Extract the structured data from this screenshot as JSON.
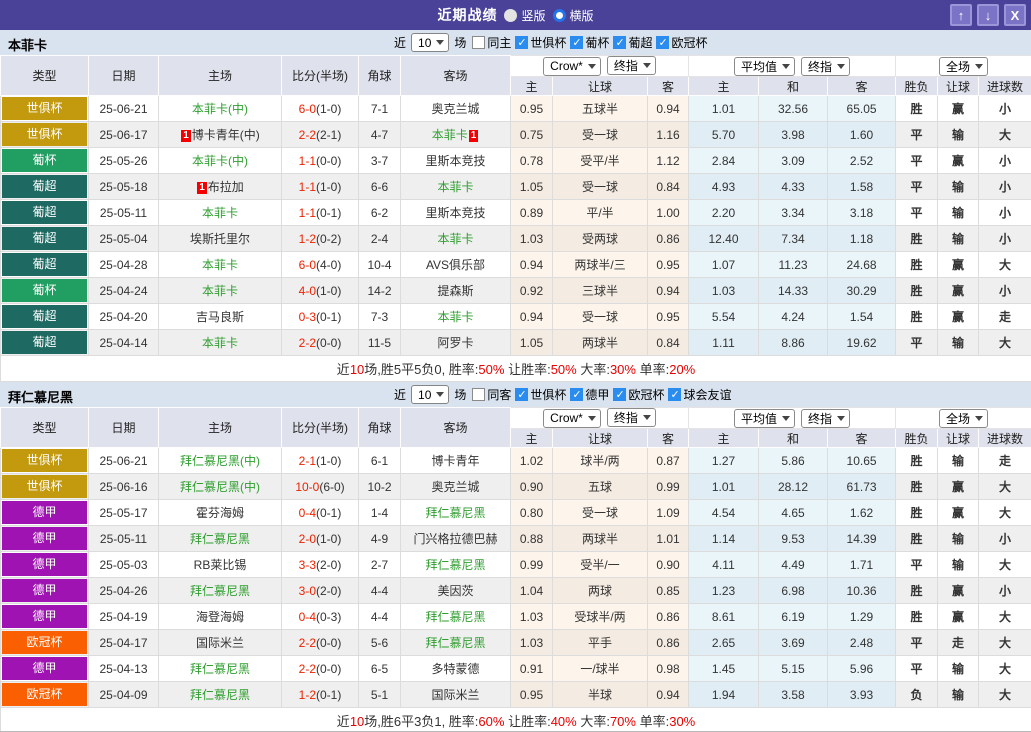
{
  "titlebar": {
    "title": "近期战绩",
    "radios": [
      {
        "label": "竖版"
      },
      {
        "label": "横版"
      }
    ],
    "buttons": [
      {
        "name": "move-up-button",
        "icon": "up-arrow-icon",
        "glyph": "↑"
      },
      {
        "name": "move-down-button",
        "icon": "down-arrow-icon",
        "glyph": "↓"
      },
      {
        "name": "close-button",
        "icon": "close-icon",
        "glyph": "X"
      }
    ]
  },
  "columns": {
    "left": [
      "类型",
      "日期",
      "主场",
      "比分(半场)",
      "角球",
      "客场"
    ],
    "sub": [
      "主",
      "让球",
      "客",
      "主",
      "和",
      "客",
      "胜负",
      "让球",
      "进球数"
    ]
  },
  "colors": {
    "accent_purple": "#4a4298",
    "worldclub": "#c3990e",
    "pt_cup": "#219e61",
    "pt_league": "#1e6a62",
    "bundesliga": "#a013b3",
    "ucl": "#fa5f02",
    "win_red": "#e60000",
    "draw_green": "#1f9a1f",
    "loss_blue": "#2222cc"
  },
  "sections": [
    {
      "team": "本菲卡",
      "filter": {
        "near": "近",
        "count": "10",
        "games": "场",
        "same": "同主",
        "same_checked": false,
        "leagues": [
          "世俱杯",
          "葡杯",
          "葡超",
          "欧冠杯"
        ]
      },
      "selects": {
        "book": "Crow*",
        "book_type": "终指",
        "avg": "平均值",
        "avg_type": "终指",
        "scope": "全场"
      },
      "rows": [
        {
          "lg": "世俱杯",
          "lc": "#c3990e",
          "dt": "25-06-21",
          "hm": "本菲卡(中)",
          "hg": true,
          "hcard": false,
          "sc": "6-0",
          "hf": "(1-0)",
          "cn": "7-1",
          "aw": "奥克兰城",
          "ag": false,
          "acard": false,
          "o1": "0.95",
          "ln": "五球半",
          "o2": "0.94",
          "m1": "1.01",
          "m2": "32.56",
          "m3": "65.05",
          "r1": "胜",
          "c1": "red",
          "r2": "赢",
          "c2": "red",
          "r3": "小",
          "c3": "blue"
        },
        {
          "lg": "世俱杯",
          "lc": "#c3990e",
          "dt": "25-06-17",
          "hm": "博卡青年(中)",
          "hg": false,
          "hcard": true,
          "sc": "2-2",
          "hf": "(2-1)",
          "cn": "4-7",
          "aw": "本菲卡",
          "ag": true,
          "acard": true,
          "o1": "0.75",
          "ln": "受一球",
          "o2": "1.16",
          "m1": "5.70",
          "m2": "3.98",
          "m3": "1.60",
          "r1": "平",
          "c1": "green",
          "r2": "输",
          "c2": "blue",
          "r3": "大",
          "c3": "red"
        },
        {
          "lg": "葡杯",
          "lc": "#219e61",
          "dt": "25-05-26",
          "hm": "本菲卡(中)",
          "hg": true,
          "hcard": false,
          "sc": "1-1",
          "hf": "(0-0)",
          "cn": "3-7",
          "aw": "里斯本竞技",
          "ag": false,
          "acard": false,
          "o1": "0.78",
          "ln": "受平/半",
          "o2": "1.12",
          "m1": "2.84",
          "m2": "3.09",
          "m3": "2.52",
          "r1": "平",
          "c1": "green",
          "r2": "赢",
          "c2": "red",
          "r3": "小",
          "c3": "blue"
        },
        {
          "lg": "葡超",
          "lc": "#1e6a62",
          "dt": "25-05-18",
          "hm": "布拉加",
          "hg": false,
          "hcard": true,
          "sc": "1-1",
          "hf": "(1-0)",
          "cn": "6-6",
          "aw": "本菲卡",
          "ag": true,
          "acard": false,
          "o1": "1.05",
          "ln": "受一球",
          "o2": "0.84",
          "m1": "4.93",
          "m2": "4.33",
          "m3": "1.58",
          "r1": "平",
          "c1": "green",
          "r2": "输",
          "c2": "blue",
          "r3": "小",
          "c3": "blue"
        },
        {
          "lg": "葡超",
          "lc": "#1e6a62",
          "dt": "25-05-11",
          "hm": "本菲卡",
          "hg": true,
          "hcard": false,
          "sc": "1-1",
          "hf": "(0-1)",
          "cn": "6-2",
          "aw": "里斯本竞技",
          "ag": false,
          "acard": false,
          "o1": "0.89",
          "ln": "平/半",
          "o2": "1.00",
          "m1": "2.20",
          "m2": "3.34",
          "m3": "3.18",
          "r1": "平",
          "c1": "green",
          "r2": "输",
          "c2": "blue",
          "r3": "小",
          "c3": "blue"
        },
        {
          "lg": "葡超",
          "lc": "#1e6a62",
          "dt": "25-05-04",
          "hm": "埃斯托里尔",
          "hg": false,
          "hcard": false,
          "sc": "1-2",
          "hf": "(0-2)",
          "cn": "2-4",
          "aw": "本菲卡",
          "ag": true,
          "acard": false,
          "o1": "1.03",
          "ln": "受两球",
          "o2": "0.86",
          "m1": "12.40",
          "m2": "7.34",
          "m3": "1.18",
          "r1": "胜",
          "c1": "red",
          "r2": "输",
          "c2": "blue",
          "r3": "小",
          "c3": "blue"
        },
        {
          "lg": "葡超",
          "lc": "#1e6a62",
          "dt": "25-04-28",
          "hm": "本菲卡",
          "hg": true,
          "hcard": false,
          "sc": "6-0",
          "hf": "(4-0)",
          "cn": "10-4",
          "aw": "AVS俱乐部",
          "ag": false,
          "acard": false,
          "o1": "0.94",
          "ln": "两球半/三",
          "o2": "0.95",
          "m1": "1.07",
          "m2": "11.23",
          "m3": "24.68",
          "r1": "胜",
          "c1": "red",
          "r2": "赢",
          "c2": "red",
          "r3": "大",
          "c3": "red"
        },
        {
          "lg": "葡杯",
          "lc": "#219e61",
          "dt": "25-04-24",
          "hm": "本菲卡",
          "hg": true,
          "hcard": false,
          "sc": "4-0",
          "hf": "(1-0)",
          "cn": "14-2",
          "aw": "提森斯",
          "ag": false,
          "acard": false,
          "o1": "0.92",
          "ln": "三球半",
          "o2": "0.94",
          "m1": "1.03",
          "m2": "14.33",
          "m3": "30.29",
          "r1": "胜",
          "c1": "red",
          "r2": "赢",
          "c2": "red",
          "r3": "小",
          "c3": "blue"
        },
        {
          "lg": "葡超",
          "lc": "#1e6a62",
          "dt": "25-04-20",
          "hm": "吉马良斯",
          "hg": false,
          "hcard": false,
          "sc": "0-3",
          "hf": "(0-1)",
          "cn": "7-3",
          "aw": "本菲卡",
          "ag": true,
          "acard": false,
          "o1": "0.94",
          "ln": "受一球",
          "o2": "0.95",
          "m1": "5.54",
          "m2": "4.24",
          "m3": "1.54",
          "r1": "胜",
          "c1": "red",
          "r2": "赢",
          "c2": "red",
          "r3": "走",
          "c3": "green"
        },
        {
          "lg": "葡超",
          "lc": "#1e6a62",
          "dt": "25-04-14",
          "hm": "本菲卡",
          "hg": true,
          "hcard": false,
          "sc": "2-2",
          "hf": "(0-0)",
          "cn": "11-5",
          "aw": "阿罗卡",
          "ag": false,
          "acard": false,
          "o1": "1.05",
          "ln": "两球半",
          "o2": "0.84",
          "m1": "1.11",
          "m2": "8.86",
          "m3": "19.62",
          "r1": "平",
          "c1": "green",
          "r2": "输",
          "c2": "blue",
          "r3": "大",
          "c3": "red"
        }
      ],
      "summary": [
        {
          "t": "近",
          "red": false
        },
        {
          "t": "10",
          "red": true
        },
        {
          "t": "场,胜5平5负0, 胜率:",
          "red": false
        },
        {
          "t": "50%",
          "red": true
        },
        {
          "t": " 让胜率:",
          "red": false
        },
        {
          "t": "50%",
          "red": true
        },
        {
          "t": " 大率:",
          "red": false
        },
        {
          "t": "30%",
          "red": true
        },
        {
          "t": " 单率:",
          "red": false
        },
        {
          "t": "20%",
          "red": true
        }
      ]
    },
    {
      "team": "拜仁慕尼黑",
      "filter": {
        "near": "近",
        "count": "10",
        "games": "场",
        "same": "同客",
        "same_checked": false,
        "leagues": [
          "世俱杯",
          "德甲",
          "欧冠杯",
          "球会友谊"
        ]
      },
      "selects": {
        "book": "Crow*",
        "book_type": "终指",
        "avg": "平均值",
        "avg_type": "终指",
        "scope": "全场"
      },
      "rows": [
        {
          "lg": "世俱杯",
          "lc": "#c3990e",
          "dt": "25-06-21",
          "hm": "拜仁慕尼黑(中)",
          "hg": true,
          "hcard": false,
          "sc": "2-1",
          "hf": "(1-0)",
          "cn": "6-1",
          "aw": "博卡青年",
          "ag": false,
          "acard": false,
          "o1": "1.02",
          "ln": "球半/两",
          "o2": "0.87",
          "m1": "1.27",
          "m2": "5.86",
          "m3": "10.65",
          "r1": "胜",
          "c1": "red",
          "r2": "输",
          "c2": "blue",
          "r3": "走",
          "c3": "green"
        },
        {
          "lg": "世俱杯",
          "lc": "#c3990e",
          "dt": "25-06-16",
          "hm": "拜仁慕尼黑(中)",
          "hg": true,
          "hcard": false,
          "sc": "10-0",
          "hf": "(6-0)",
          "cn": "10-2",
          "aw": "奥克兰城",
          "ag": false,
          "acard": false,
          "o1": "0.90",
          "ln": "五球",
          "o2": "0.99",
          "m1": "1.01",
          "m2": "28.12",
          "m3": "61.73",
          "r1": "胜",
          "c1": "red",
          "r2": "赢",
          "c2": "red",
          "r3": "大",
          "c3": "red"
        },
        {
          "lg": "德甲",
          "lc": "#a013b3",
          "dt": "25-05-17",
          "hm": "霍芬海姆",
          "hg": false,
          "hcard": false,
          "sc": "0-4",
          "hf": "(0-1)",
          "cn": "1-4",
          "aw": "拜仁慕尼黑",
          "ag": true,
          "acard": false,
          "o1": "0.80",
          "ln": "受一球",
          "o2": "1.09",
          "m1": "4.54",
          "m2": "4.65",
          "m3": "1.62",
          "r1": "胜",
          "c1": "red",
          "r2": "赢",
          "c2": "red",
          "r3": "大",
          "c3": "red"
        },
        {
          "lg": "德甲",
          "lc": "#a013b3",
          "dt": "25-05-11",
          "hm": "拜仁慕尼黑",
          "hg": true,
          "hcard": false,
          "sc": "2-0",
          "hf": "(1-0)",
          "cn": "4-9",
          "aw": "门兴格拉德巴赫",
          "ag": false,
          "acard": false,
          "o1": "0.88",
          "ln": "两球半",
          "o2": "1.01",
          "m1": "1.14",
          "m2": "9.53",
          "m3": "14.39",
          "r1": "胜",
          "c1": "red",
          "r2": "输",
          "c2": "blue",
          "r3": "小",
          "c3": "blue"
        },
        {
          "lg": "德甲",
          "lc": "#a013b3",
          "dt": "25-05-03",
          "hm": "RB莱比锡",
          "hg": false,
          "hcard": false,
          "sc": "3-3",
          "hf": "(2-0)",
          "cn": "2-7",
          "aw": "拜仁慕尼黑",
          "ag": true,
          "acard": false,
          "o1": "0.99",
          "ln": "受半/一",
          "o2": "0.90",
          "m1": "4.11",
          "m2": "4.49",
          "m3": "1.71",
          "r1": "平",
          "c1": "green",
          "r2": "输",
          "c2": "blue",
          "r3": "大",
          "c3": "red"
        },
        {
          "lg": "德甲",
          "lc": "#a013b3",
          "dt": "25-04-26",
          "hm": "拜仁慕尼黑",
          "hg": true,
          "hcard": false,
          "sc": "3-0",
          "hf": "(2-0)",
          "cn": "4-4",
          "aw": "美因茨",
          "ag": false,
          "acard": false,
          "o1": "1.04",
          "ln": "两球",
          "o2": "0.85",
          "m1": "1.23",
          "m2": "6.98",
          "m3": "10.36",
          "r1": "胜",
          "c1": "red",
          "r2": "赢",
          "c2": "red",
          "r3": "小",
          "c3": "blue"
        },
        {
          "lg": "德甲",
          "lc": "#a013b3",
          "dt": "25-04-19",
          "hm": "海登海姆",
          "hg": false,
          "hcard": false,
          "sc": "0-4",
          "hf": "(0-3)",
          "cn": "4-4",
          "aw": "拜仁慕尼黑",
          "ag": true,
          "acard": false,
          "o1": "1.03",
          "ln": "受球半/两",
          "o2": "0.86",
          "m1": "8.61",
          "m2": "6.19",
          "m3": "1.29",
          "r1": "胜",
          "c1": "red",
          "r2": "赢",
          "c2": "red",
          "r3": "大",
          "c3": "red"
        },
        {
          "lg": "欧冠杯",
          "lc": "#fa5f02",
          "dt": "25-04-17",
          "hm": "国际米兰",
          "hg": false,
          "hcard": false,
          "sc": "2-2",
          "hf": "(0-0)",
          "cn": "5-6",
          "aw": "拜仁慕尼黑",
          "ag": true,
          "acard": false,
          "o1": "1.03",
          "ln": "平手",
          "o2": "0.86",
          "m1": "2.65",
          "m2": "3.69",
          "m3": "2.48",
          "r1": "平",
          "c1": "green",
          "r2": "走",
          "c2": "green",
          "r3": "大",
          "c3": "red"
        },
        {
          "lg": "德甲",
          "lc": "#a013b3",
          "dt": "25-04-13",
          "hm": "拜仁慕尼黑",
          "hg": true,
          "hcard": false,
          "sc": "2-2",
          "hf": "(0-0)",
          "cn": "6-5",
          "aw": "多特蒙德",
          "ag": false,
          "acard": false,
          "o1": "0.91",
          "ln": "一/球半",
          "o2": "0.98",
          "m1": "1.45",
          "m2": "5.15",
          "m3": "5.96",
          "r1": "平",
          "c1": "green",
          "r2": "输",
          "c2": "blue",
          "r3": "大",
          "c3": "red"
        },
        {
          "lg": "欧冠杯",
          "lc": "#fa5f02",
          "dt": "25-04-09",
          "hm": "拜仁慕尼黑",
          "hg": true,
          "hcard": false,
          "sc": "1-2",
          "hf": "(0-1)",
          "cn": "5-1",
          "aw": "国际米兰",
          "ag": false,
          "acard": false,
          "o1": "0.95",
          "ln": "半球",
          "o2": "0.94",
          "m1": "1.94",
          "m2": "3.58",
          "m3": "3.93",
          "r1": "负",
          "c1": "blue",
          "r2": "输",
          "c2": "blue",
          "r3": "大",
          "c3": "red"
        }
      ],
      "summary": [
        {
          "t": "近",
          "red": false
        },
        {
          "t": "10",
          "red": true
        },
        {
          "t": "场,胜6平3负1, 胜率:",
          "red": false
        },
        {
          "t": "60%",
          "red": true
        },
        {
          "t": " 让胜率:",
          "red": false
        },
        {
          "t": "40%",
          "red": true
        },
        {
          "t": " 大率:",
          "red": false
        },
        {
          "t": "70%",
          "red": true
        },
        {
          "t": " 单率:",
          "red": false
        },
        {
          "t": "30%",
          "red": true
        }
      ]
    }
  ]
}
